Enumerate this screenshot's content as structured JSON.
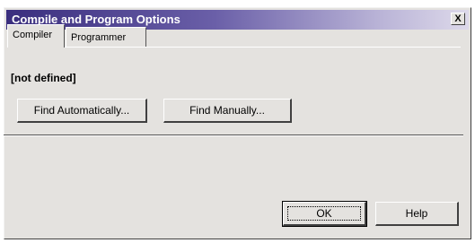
{
  "window": {
    "title": "Compile and Program Options",
    "close_label": "X"
  },
  "tabs": [
    {
      "label": "Compiler",
      "active": true
    },
    {
      "label": "Programmer",
      "active": false
    }
  ],
  "compiler_panel": {
    "status_text": "[not defined]",
    "find_automatically_label": "Find Automatically...",
    "find_manually_label": "Find Manually..."
  },
  "footer": {
    "ok_label": "OK",
    "help_label": "Help"
  },
  "colors": {
    "titlebar_start": "#3a2e7e",
    "titlebar_end": "#ddd9ea",
    "dialog_face": "#e4e2df"
  }
}
